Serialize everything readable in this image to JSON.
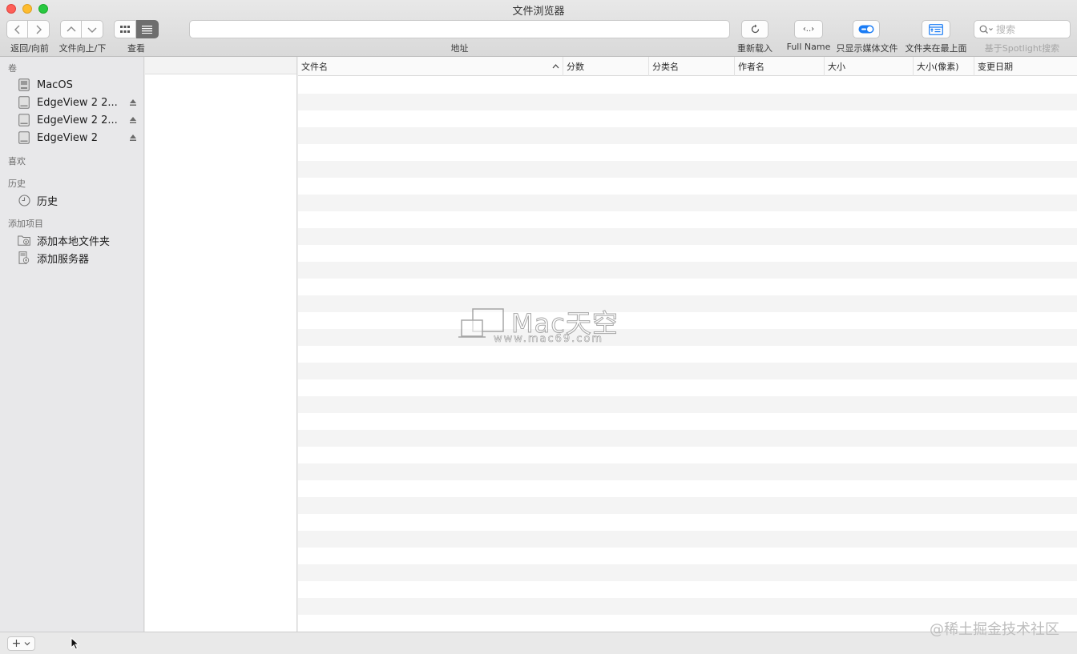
{
  "window": {
    "title": "文件浏览器"
  },
  "toolbar": {
    "back_forward_label": "返回/向前",
    "up_down_label": "文件向上/下",
    "view_label": "查看",
    "address_label": "地址",
    "address_value": "",
    "reload_label": "重新载入",
    "fullname_label": "Full Name",
    "media_only_label": "只显示媒体文件",
    "folders_top_label": "文件夹在最上面",
    "spotlight_label": "基于Spotlight搜索",
    "search_placeholder": "搜索",
    "fullname_icon_text": "‹..›"
  },
  "sidebar": {
    "sections": {
      "volumes": "卷",
      "favorites": "喜欢",
      "history": "历史",
      "add": "添加项目"
    },
    "volumes": [
      {
        "label": "MacOS",
        "icon": "hard-disk-icon",
        "eject": false
      },
      {
        "label": "EdgeView 2 2...",
        "icon": "disk-icon",
        "eject": true
      },
      {
        "label": "EdgeView 2 2...",
        "icon": "disk-icon",
        "eject": true
      },
      {
        "label": "EdgeView 2",
        "icon": "disk-icon",
        "eject": true
      }
    ],
    "history_item": {
      "label": "历史",
      "icon": "clock-icon"
    },
    "add_items": [
      {
        "label": "添加本地文件夹",
        "icon": "folder-add-icon"
      },
      {
        "label": "添加服务器",
        "icon": "server-add-icon"
      }
    ]
  },
  "table": {
    "columns": [
      "文件名",
      "分数",
      "分类名",
      "作者名",
      "大小",
      "大小(像素)",
      "变更日期"
    ],
    "rows": []
  },
  "watermark": {
    "brand": "Mac天空",
    "url": "www.mac69.com"
  },
  "footer": {
    "add_button": "+",
    "watermark_text": "@稀土掘金技术社区"
  },
  "colors": {
    "close": "#fe5f57",
    "minimize": "#febc2e",
    "maximize": "#28c840",
    "toggle_accent": "#1a7cf5"
  }
}
